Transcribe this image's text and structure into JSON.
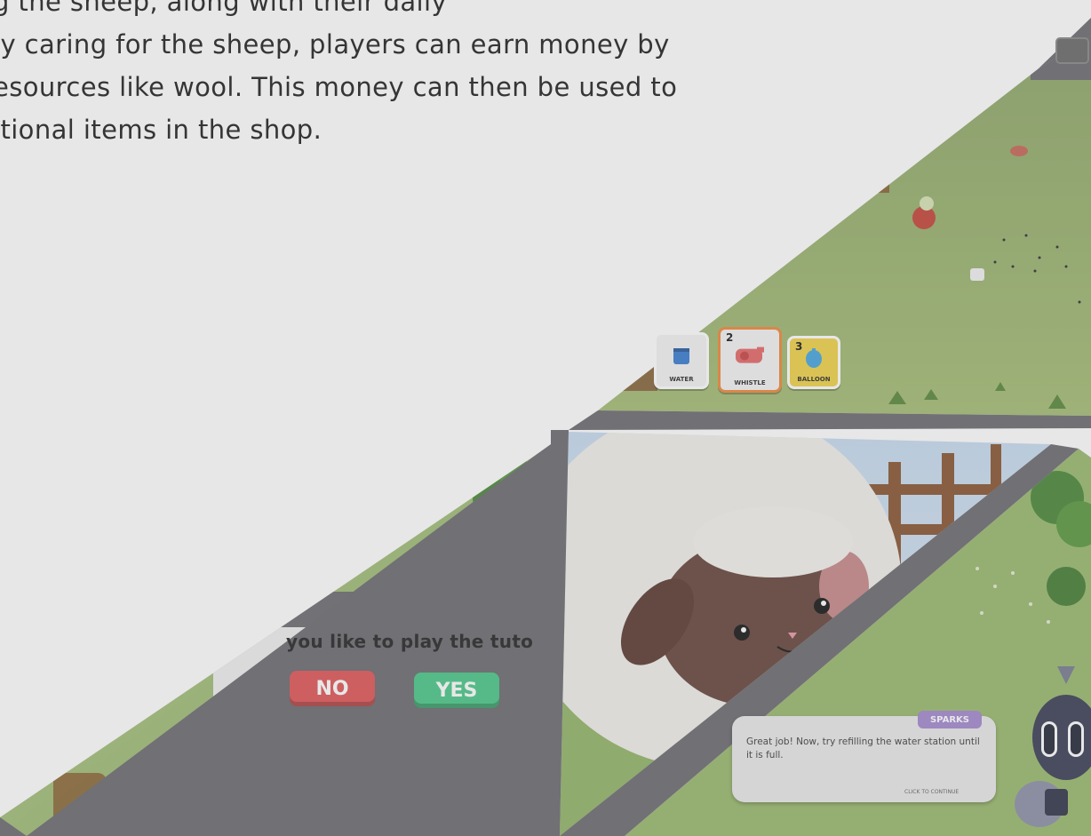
{
  "intro": {
    "lines": [
      "g the sheep, along with their daily",
      "ly caring for the sheep, players can earn money by",
      "esources like wool. This money can then be used to",
      "itional items in the shop."
    ]
  },
  "hotbar": [
    {
      "number": "",
      "label": "WATER",
      "icon": "water-bucket-icon"
    },
    {
      "number": "2",
      "label": "WHISTLE",
      "icon": "whistle-icon",
      "selected": true
    },
    {
      "number": "3",
      "label": "BALLOON",
      "icon": "balloon-icon"
    }
  ],
  "tutorial_prompt": {
    "question": "you like to play the tuto",
    "no_label": "NO",
    "yes_label": "YES"
  },
  "dialog": {
    "speaker": "SPARKS",
    "text": "Great job! Now, try refilling the water station until it is full.",
    "continue_hint": "CLICK TO CONTINUE"
  },
  "colors": {
    "panel_divider": "#6e6e73",
    "grass": "#93b56a",
    "no_button": "#e05a5a",
    "yes_button": "#4ec989",
    "selected_slot_border": "#f08a3c",
    "speaker_tag": "#a58ccf"
  }
}
